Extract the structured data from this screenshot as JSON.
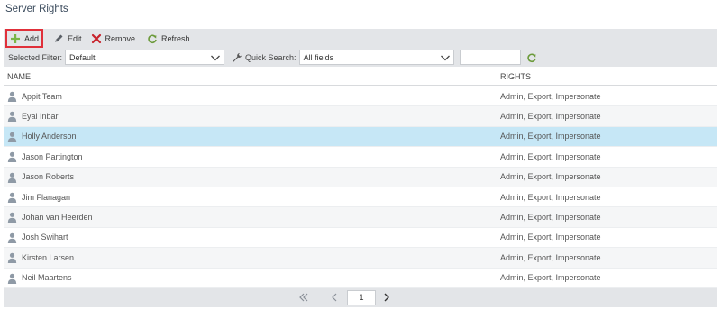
{
  "page": {
    "title": "Server Rights"
  },
  "toolbar": {
    "add_label": "Add",
    "edit_label": "Edit",
    "remove_label": "Remove",
    "refresh_label": "Refresh"
  },
  "filter": {
    "selected_filter_label": "Selected Filter:",
    "selected_filter_value": "Default",
    "quick_search_label": "Quick Search:",
    "quick_search_field": "All fields",
    "search_text": ""
  },
  "grid": {
    "columns": {
      "name": "NAME",
      "rights": "RIGHTS"
    },
    "rows": [
      {
        "name": "Appit Team",
        "rights": "Admin, Export, Impersonate"
      },
      {
        "name": "Eyal Inbar",
        "rights": "Admin, Export, Impersonate"
      },
      {
        "name": "Holly Anderson",
        "rights": "Admin, Export, Impersonate"
      },
      {
        "name": "Jason Partington",
        "rights": "Admin, Export, Impersonate"
      },
      {
        "name": "Jason Roberts",
        "rights": "Admin, Export, Impersonate"
      },
      {
        "name": "Jim Flanagan",
        "rights": "Admin, Export, Impersonate"
      },
      {
        "name": "Johan van Heerden",
        "rights": "Admin, Export, Impersonate"
      },
      {
        "name": "Josh Swihart",
        "rights": "Admin, Export, Impersonate"
      },
      {
        "name": "Kirsten Larsen",
        "rights": "Admin, Export, Impersonate"
      },
      {
        "name": "Neil Maartens",
        "rights": "Admin, Export, Impersonate"
      }
    ],
    "selected_row": "Holly Anderson"
  },
  "pager": {
    "current_page": "1"
  },
  "colors": {
    "accent_red": "#e0303a",
    "add_green": "#7ab648",
    "selected_row": "#c6e7f6",
    "toolbar_bg": "#e3e5e8"
  },
  "icons": {
    "add": "plus-icon",
    "edit": "pencil-icon",
    "remove": "x-icon",
    "refresh": "refresh-icon",
    "user": "user-icon",
    "wrench": "wrench-icon"
  }
}
